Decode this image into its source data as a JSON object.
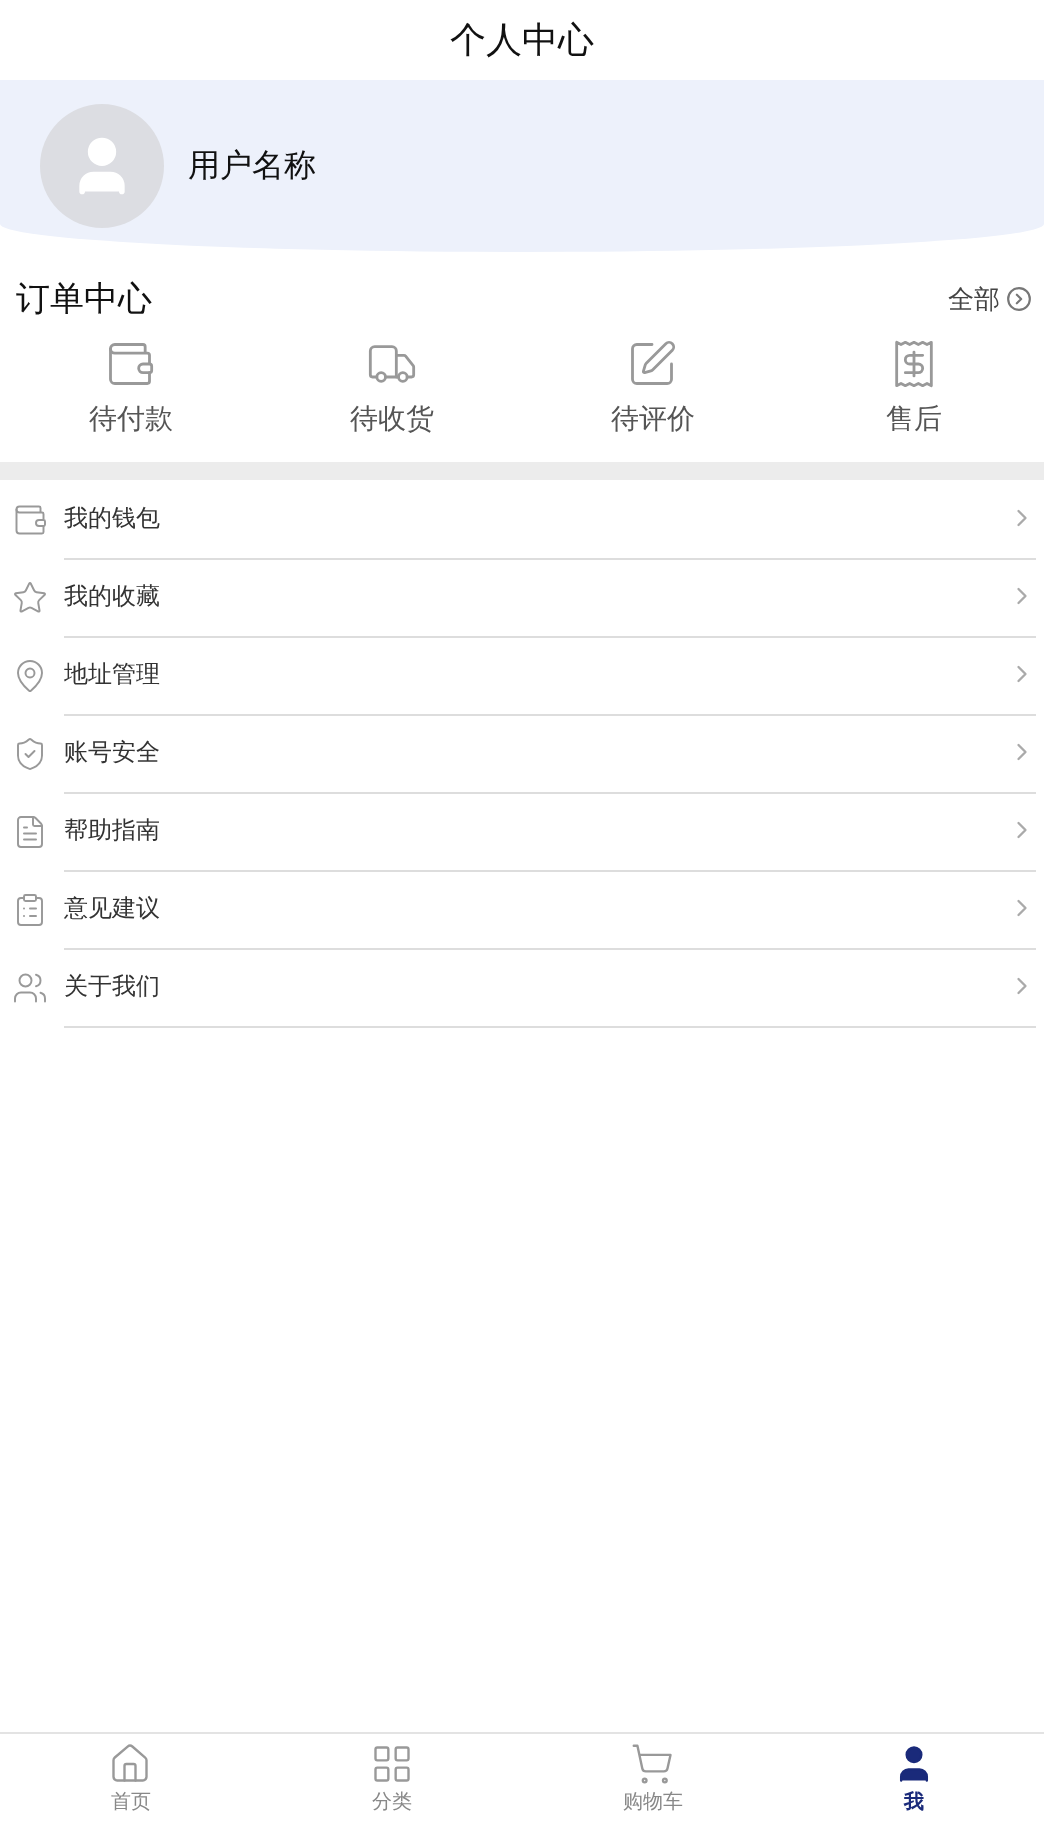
{
  "header": {
    "title": "个人中心"
  },
  "profile": {
    "username": "用户名称"
  },
  "orders": {
    "title": "订单中心",
    "all_link": "全部",
    "items": [
      {
        "kind": "payment",
        "label": "待付款"
      },
      {
        "kind": "delivery",
        "label": "待收货"
      },
      {
        "kind": "review",
        "label": "待评价"
      },
      {
        "kind": "aftersale",
        "label": "售后"
      }
    ]
  },
  "menu": [
    {
      "kind": "wallet",
      "label": "我的钱包"
    },
    {
      "kind": "favorites",
      "label": "我的收藏"
    },
    {
      "kind": "address",
      "label": "地址管理"
    },
    {
      "kind": "security",
      "label": "账号安全"
    },
    {
      "kind": "help",
      "label": "帮助指南"
    },
    {
      "kind": "feedback",
      "label": "意见建议"
    },
    {
      "kind": "about",
      "label": "关于我们"
    }
  ],
  "tab_bar": [
    {
      "kind": "home",
      "label": "首页",
      "selected": false
    },
    {
      "kind": "category",
      "label": "分类",
      "selected": false
    },
    {
      "kind": "cart",
      "label": "购物车",
      "selected": false
    },
    {
      "kind": "me",
      "label": "我",
      "selected": true
    }
  ]
}
